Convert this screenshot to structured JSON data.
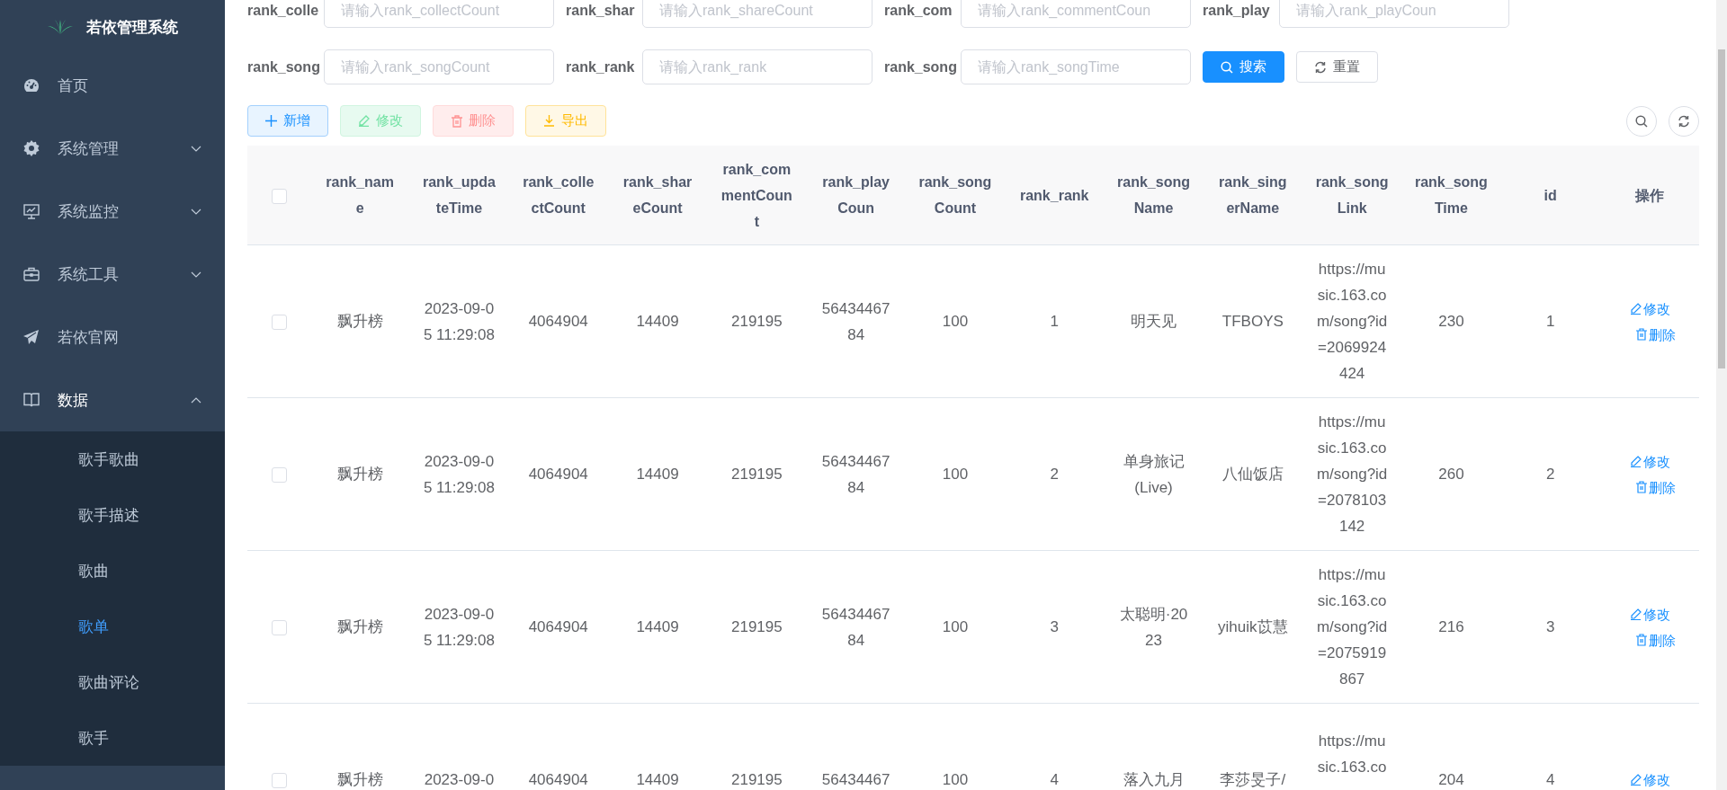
{
  "sidebar": {
    "title": "若依管理系统",
    "items": [
      {
        "label": "首页"
      },
      {
        "label": "系统管理",
        "expanded": false
      },
      {
        "label": "系统监控",
        "expanded": false
      },
      {
        "label": "系统工具",
        "expanded": false
      },
      {
        "label": "若依官网"
      },
      {
        "label": "数据",
        "expanded": true,
        "children": [
          {
            "label": "歌手歌曲",
            "selected": false
          },
          {
            "label": "歌手描述",
            "selected": false
          },
          {
            "label": "歌曲",
            "selected": false
          },
          {
            "label": "歌单",
            "selected": true
          },
          {
            "label": "歌曲评论",
            "selected": false
          },
          {
            "label": "歌手",
            "selected": false
          }
        ]
      }
    ]
  },
  "search_form": {
    "rows": [
      [
        {
          "label": "rank_colle",
          "placeholder": "请输入rank_collectCount"
        },
        {
          "label": "rank_shar",
          "placeholder": "请输入rank_shareCount"
        },
        {
          "label": "rank_com",
          "placeholder": "请输入rank_commentCoun"
        },
        {
          "label": "rank_play",
          "placeholder": "请输入rank_playCoun"
        }
      ],
      [
        {
          "label": "rank_song",
          "placeholder": "请输入rank_songCount"
        },
        {
          "label": "rank_rank",
          "placeholder": "请输入rank_rank"
        },
        {
          "label": "rank_song",
          "placeholder": "请输入rank_songTime"
        }
      ]
    ],
    "buttons": [
      {
        "label": "搜索",
        "kind": "primary"
      },
      {
        "label": "重置",
        "kind": "default"
      }
    ]
  },
  "toolbar": {
    "buttons": [
      {
        "label": "新增",
        "kind": "primary",
        "disabled": false
      },
      {
        "label": "修改",
        "kind": "success",
        "disabled": true
      },
      {
        "label": "删除",
        "kind": "danger",
        "disabled": true
      },
      {
        "label": "导出",
        "kind": "warning",
        "disabled": false
      }
    ]
  },
  "table": {
    "header_checked": false,
    "columns": [
      "rank_name",
      "rank_updateTime",
      "rank_collectCount",
      "rank_shareCount",
      "rank_commentCount",
      "rank_playCoun",
      "rank_songCount",
      "rank_rank",
      "rank_songName",
      "rank_singerName",
      "rank_songLink",
      "rank_songTime",
      "id",
      "操作"
    ],
    "rows": [
      {
        "selected": false,
        "cells": [
          "飘升榜",
          "2023-09-05 11:29:08",
          "4064904",
          "14409",
          "219195",
          "5643446784",
          "100",
          "1",
          "明天见",
          "TFBOYS",
          "https://music.163.com/song?id=2069924424",
          "230",
          "1"
        ],
        "actions": [
          "修改",
          "删除"
        ]
      },
      {
        "selected": false,
        "cells": [
          "飘升榜",
          "2023-09-05 11:29:08",
          "4064904",
          "14409",
          "219195",
          "5643446784",
          "100",
          "2",
          "单身旅记(Live)",
          "八仙饭店",
          "https://music.163.com/song?id=2078103142",
          "260",
          "2"
        ],
        "actions": [
          "修改",
          "删除"
        ]
      },
      {
        "selected": false,
        "cells": [
          "飘升榜",
          "2023-09-05 11:29:08",
          "4064904",
          "14409",
          "219195",
          "5643446784",
          "100",
          "3",
          "太聪明·2023",
          "yihuik苡慧",
          "https://music.163.com/song?id=2075919867",
          "216",
          "3"
        ],
        "actions": [
          "修改",
          "删除"
        ]
      },
      {
        "selected": false,
        "cells": [
          "飘升榜",
          "2023-09-0",
          "4064904",
          "14409",
          "219195",
          "56434467",
          "100",
          "4",
          "落入九月",
          "李莎旻子/",
          "https://music.163.co",
          "204",
          "4"
        ],
        "actions": [
          "修改"
        ]
      }
    ]
  }
}
